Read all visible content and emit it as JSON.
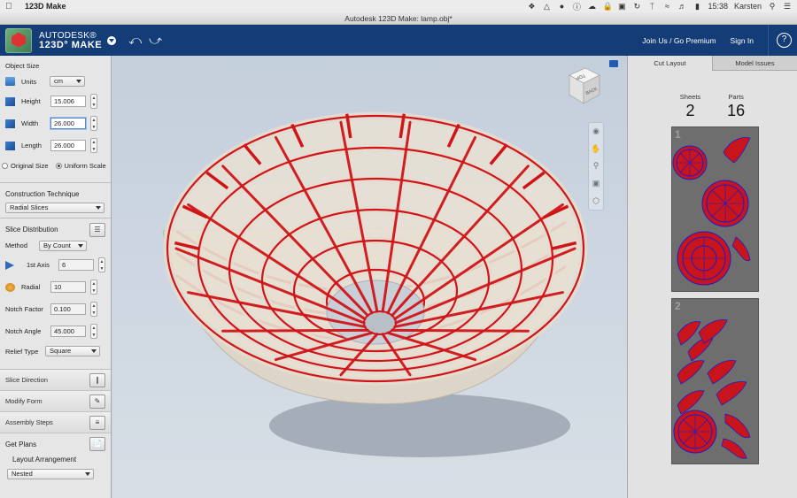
{
  "menubar": {
    "app_name": "123D Make",
    "user": "Karsten",
    "time": "15:38"
  },
  "window": {
    "title": "Autodesk 123D Make: lamp.obj*"
  },
  "header": {
    "brand_line1": "AUTODESK®",
    "brand_line2": "123D° MAKE",
    "join_link": "Join Us / Go Premium",
    "signin_link": "Sign In",
    "help_glyph": "?"
  },
  "left_panel": {
    "object_size": {
      "title": "Object Size",
      "units_label": "Units",
      "units_value": "cm",
      "height_label": "Height",
      "height_value": "15.006",
      "width_label": "Width",
      "width_value": "26.000",
      "length_label": "Length",
      "length_value": "26.000",
      "original_size_label": "Original Size",
      "uniform_scale_label": "Uniform Scale"
    },
    "construction": {
      "title": "Construction Technique",
      "value": "Radial Slices"
    },
    "slice_distribution": {
      "title": "Slice Distribution",
      "method_label": "Method",
      "method_value": "By Count",
      "axis1_label": "1st Axis",
      "axis1_value": "6",
      "radial_label": "Radial",
      "radial_value": "10",
      "notch_factor_label": "Notch Factor",
      "notch_factor_value": "0.100",
      "notch_angle_label": "Notch Angle",
      "notch_angle_value": "45.000",
      "relief_type_label": "Relief Type",
      "relief_type_value": "Square"
    },
    "slice_direction": {
      "title": "Slice Direction"
    },
    "modify_form": {
      "title": "Modify Form"
    },
    "assembly_steps": {
      "title": "Assembly Steps"
    },
    "get_plans": {
      "title": "Get Plans",
      "layout_label": "Layout Arrangement",
      "layout_value": "Nested"
    }
  },
  "viewport": {
    "viewcube_top": "TOP",
    "viewcube_back": "BACK",
    "accent_color": "#d01418",
    "slice_color": "#e4ddd0"
  },
  "right_panel": {
    "tabs": [
      "Cut Layout",
      "Model Issues"
    ],
    "sheets_label": "Sheets",
    "sheets_value": "2",
    "parts_label": "Parts",
    "parts_value": "16",
    "sheet1_num": "1",
    "sheet2_num": "2"
  }
}
